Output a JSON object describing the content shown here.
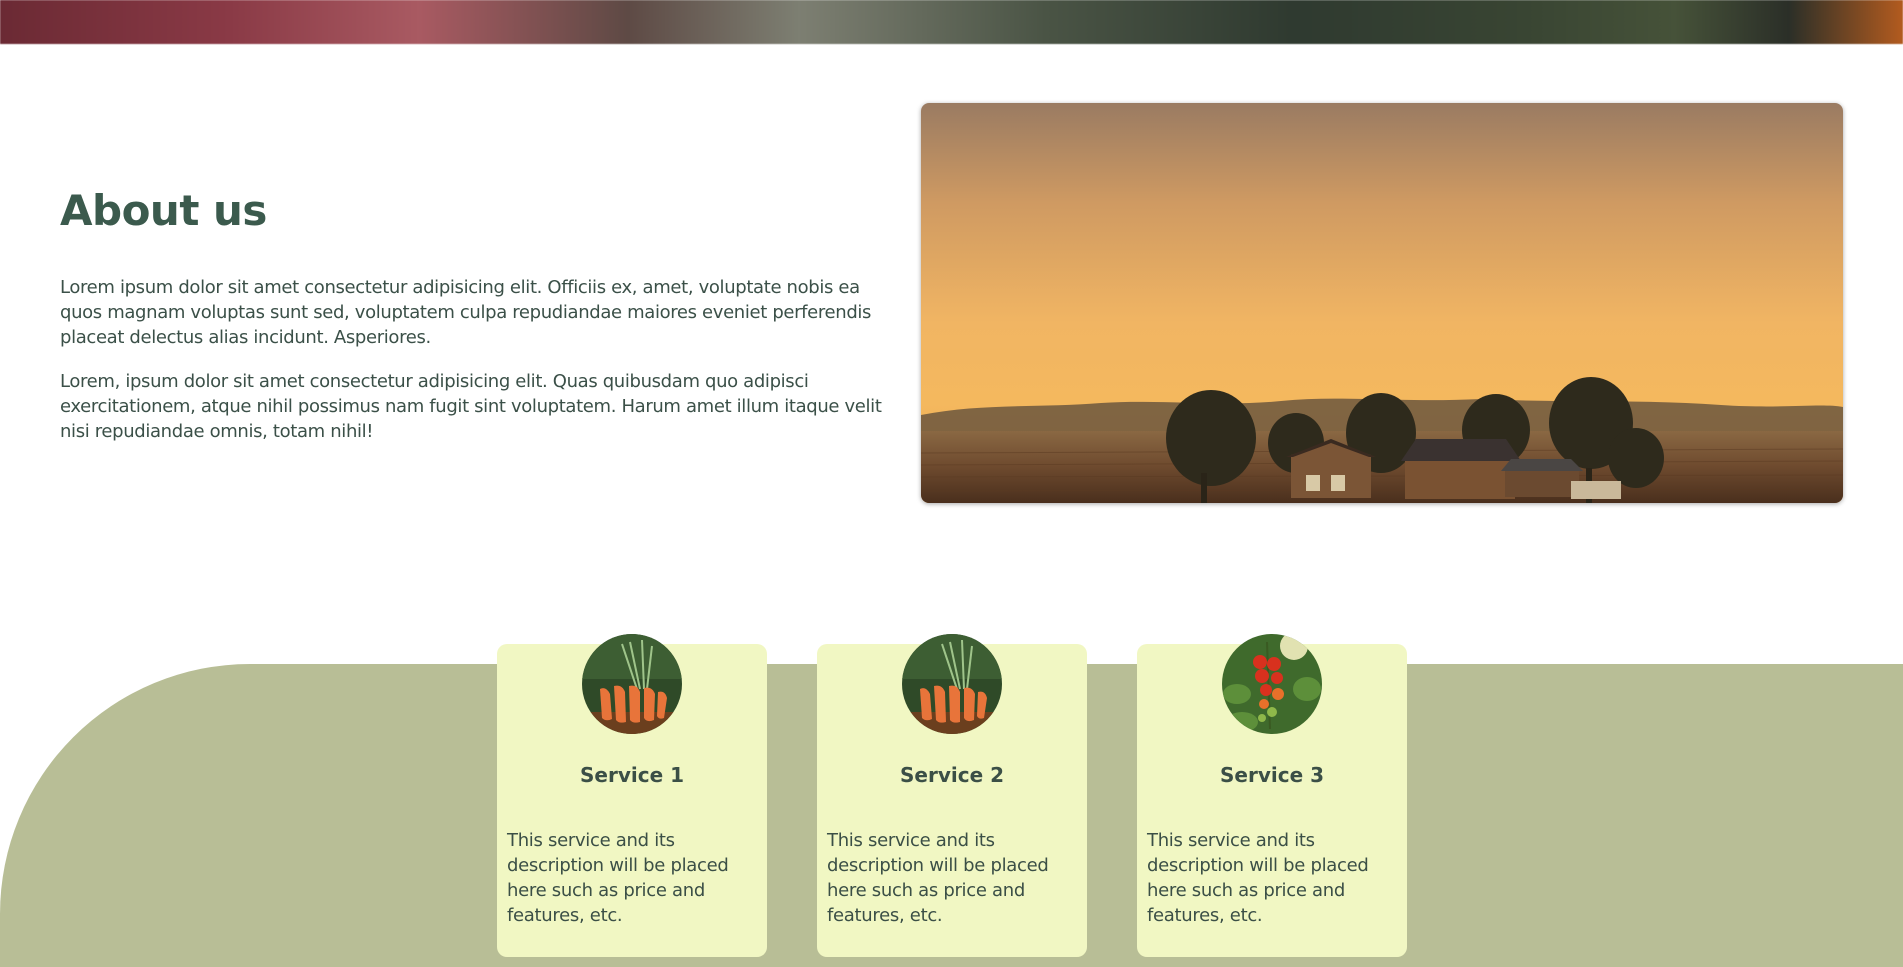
{
  "about": {
    "title": "About us",
    "paragraphs": [
      "Lorem ipsum dolor sit amet consectetur adipisicing elit. Officiis ex, amet, voluptate nobis ea quos magnam voluptas sunt sed, voluptatem culpa repudiandae maiores eveniet perferendis placeat delectus alias incidunt. Asperiores.",
      "Lorem, ipsum dolor sit amet consectetur adipisicing elit. Quas quibusdam quo adipisci exercitationem, atque nihil possimus nam fugit sint voluptatem. Harum amet illum itaque velit nisi repudiandae omnis, totam nihil!"
    ],
    "image": "farm-sunset-photo"
  },
  "services": [
    {
      "title": "Service 1",
      "description": "This service and its description will be placed here such as price and features, etc.",
      "image": "carrots-photo"
    },
    {
      "title": "Service 2",
      "description": "This service and its description will be placed here such as price and features, etc.",
      "image": "carrots-photo"
    },
    {
      "title": "Service 3",
      "description": "This service and its description will be placed here such as price and features, etc.",
      "image": "tomatoes-photo"
    }
  ],
  "colors": {
    "heading": "#3b5a4d",
    "band": "#b8be96",
    "card": "#f1f7c3"
  }
}
